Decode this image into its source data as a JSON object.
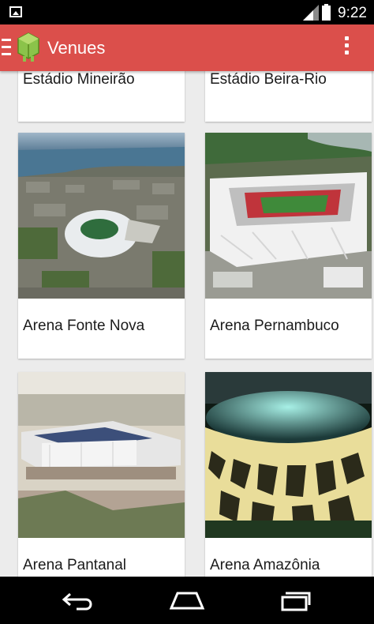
{
  "status_bar": {
    "time": "9:22",
    "icons": [
      "image-notification-icon",
      "signal-icon",
      "battery-icon"
    ]
  },
  "action_bar": {
    "title": "Venues",
    "icons": [
      "drawer-menu-icon",
      "android-app-icon",
      "overflow-menu-icon"
    ],
    "color": "#db4f4b"
  },
  "venues": [
    {
      "name": "Estádio Mineirão"
    },
    {
      "name": "Estádio Beira-Rio"
    },
    {
      "name": "Arena Fonte Nova"
    },
    {
      "name": "Arena Pernambuco"
    },
    {
      "name": "Arena Pantanal"
    },
    {
      "name": "Arena Amazônia"
    }
  ],
  "nav_bar": {
    "icons": [
      "back-icon",
      "home-icon",
      "recent-apps-icon"
    ]
  }
}
